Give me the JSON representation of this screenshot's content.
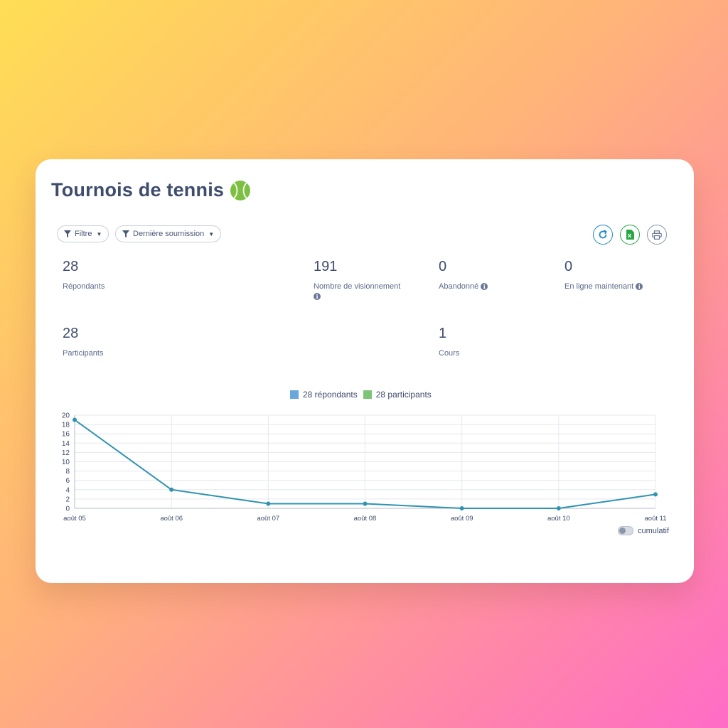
{
  "header": {
    "title": "Tournois de tennis",
    "title_icon": "tennis-ball-icon"
  },
  "toolbar": {
    "filter_label": "Filtre",
    "last_submission_label": "Dernière soumission",
    "refresh_icon": "refresh-icon",
    "excel_icon": "excel-export-icon",
    "print_icon": "print-icon",
    "colors": {
      "refresh": "#1e88c7",
      "excel": "#28a745",
      "print": "#6b778f"
    }
  },
  "stats": {
    "respondents": {
      "value": "28",
      "label": "Répondants"
    },
    "views": {
      "value": "191",
      "label": "Nombre de visionnement"
    },
    "abandoned": {
      "value": "0",
      "label": "Abandonné"
    },
    "online_now": {
      "value": "0",
      "label": "En ligne maintenant"
    },
    "participants": {
      "value": "28",
      "label": "Participants"
    },
    "courses": {
      "value": "1",
      "label": "Cours"
    }
  },
  "legend": {
    "respondents": "28 répondants",
    "participants": "28 participants",
    "respondents_color": "#6aa8dc",
    "participants_color": "#7cc576"
  },
  "chart_data": {
    "type": "line",
    "categories": [
      "août 05",
      "août 06",
      "août 07",
      "août 08",
      "août 09",
      "août 10",
      "août 11"
    ],
    "series": [
      {
        "name": "28 répondants",
        "values": [
          19,
          4,
          1,
          1,
          0,
          0,
          3
        ],
        "color": "#2f93b0"
      }
    ],
    "ylim": [
      0,
      20
    ],
    "yticks": [
      0,
      2,
      4,
      6,
      8,
      10,
      12,
      14,
      16,
      18,
      20
    ],
    "grid": true
  },
  "cumulative": {
    "label": "cumulatif",
    "enabled": false
  }
}
